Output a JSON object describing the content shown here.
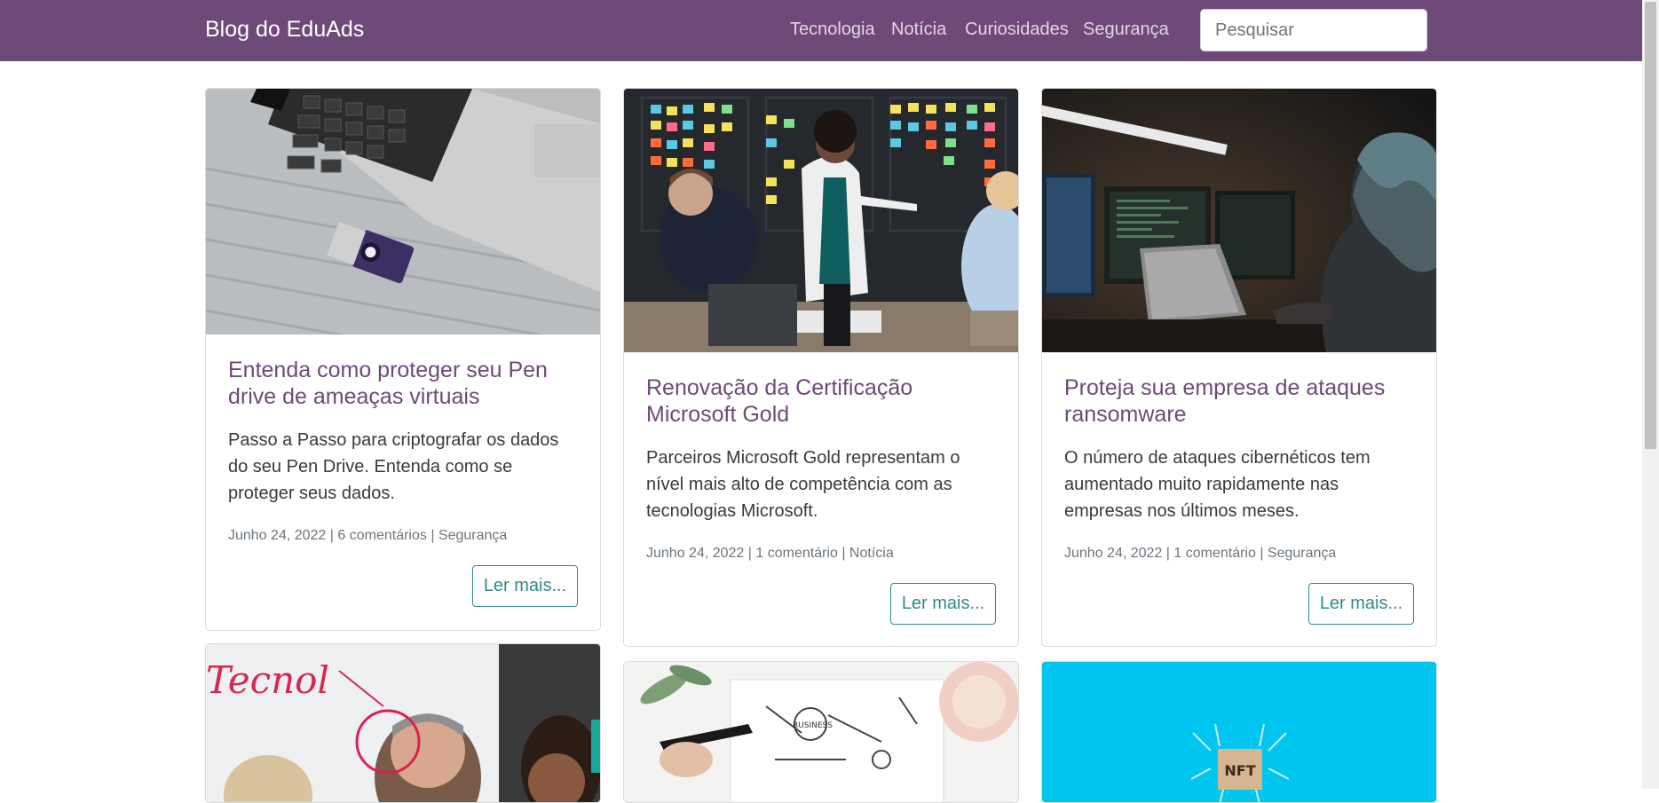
{
  "navbar": {
    "brand": "Blog do EduAds",
    "links": [
      "Tecnologia",
      "Notícia",
      "Curiosidades",
      "Segurança"
    ],
    "search_placeholder": "Pesquisar",
    "background": "#6e4a78"
  },
  "posts": [
    {
      "title": "Entenda como proteger seu Pen drive de ameaças virtuais",
      "excerpt": "Passo a Passo para criptografar os dados do seu Pen Drive. Entenda como se proteger seus dados.",
      "date": "Junho 24, 2022",
      "comments": "6 comentários",
      "category": "Segurança",
      "button": "Ler mais..."
    },
    {
      "title": "Renovação da Certificação Microsoft Gold",
      "excerpt": "Parceiros Microsoft Gold representam o nível mais alto de competência com as tecnologias Microsoft.",
      "date": "Junho 24, 2022",
      "comments": "1 comentário",
      "category": "Notícia",
      "button": "Ler mais..."
    },
    {
      "title": "Proteja sua empresa de ataques ransomware",
      "excerpt": "O número de ataques cibernéticos tem aumentado muito rapidamente nas empresas nos últimos meses.",
      "date": "Junho 24, 2022",
      "comments": "1 comentário",
      "category": "Segurança",
      "button": "Ler mais..."
    }
  ],
  "sep": " | ",
  "images": {
    "handwriting": "Tecnol",
    "business_sketch": "BUSINESS",
    "nft_label": "NFT"
  },
  "colors": {
    "accent": "#6e4a78",
    "button": "#2f8a8a",
    "nft_bg": "#00c6ef"
  }
}
